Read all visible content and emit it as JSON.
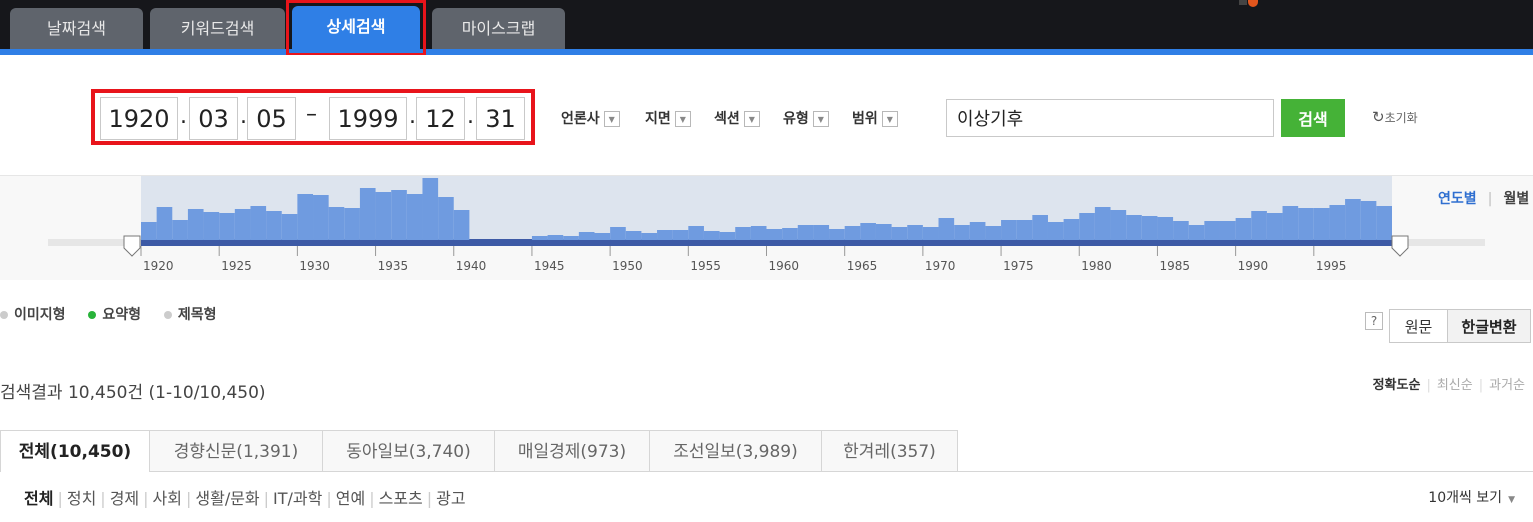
{
  "tabs": [
    {
      "label": "날짜검색",
      "active": false
    },
    {
      "label": "키워드검색",
      "active": false
    },
    {
      "label": "상세검색",
      "active": true
    },
    {
      "label": "마이스크랩",
      "active": false
    }
  ],
  "date_range": {
    "start": {
      "year": "1920",
      "month": "03",
      "day": "05"
    },
    "end": {
      "year": "1999",
      "month": "12",
      "day": "31"
    },
    "dot": ".",
    "dash": "–"
  },
  "filters": [
    "언론사",
    "지면",
    "섹션",
    "유형",
    "범위"
  ],
  "search": {
    "value": "이상기후",
    "button": "검색",
    "reset": "초기화"
  },
  "units": {
    "year": "연도별",
    "month": "월별"
  },
  "chart_data": {
    "type": "bar",
    "x_tick_labels": [
      "1920",
      "1925",
      "1930",
      "1935",
      "1940",
      "1945",
      "1950",
      "1955",
      "1960",
      "1965",
      "1970",
      "1975",
      "1980",
      "1985",
      "1990",
      "1995"
    ],
    "x": [
      1920,
      1921,
      1922,
      1923,
      1924,
      1925,
      1926,
      1927,
      1928,
      1929,
      1930,
      1931,
      1932,
      1933,
      1934,
      1935,
      1936,
      1937,
      1938,
      1939,
      1940,
      1941,
      1942,
      1943,
      1944,
      1945,
      1946,
      1947,
      1948,
      1949,
      1950,
      1951,
      1952,
      1953,
      1954,
      1955,
      1956,
      1957,
      1958,
      1959,
      1960,
      1961,
      1962,
      1963,
      1964,
      1965,
      1966,
      1967,
      1968,
      1969,
      1970,
      1971,
      1972,
      1973,
      1974,
      1975,
      1976,
      1977,
      1978,
      1979,
      1980,
      1981,
      1982,
      1983,
      1984,
      1985,
      1986,
      1987,
      1988,
      1989,
      1990,
      1991,
      1992,
      1993,
      1994,
      1995,
      1996,
      1997,
      1998,
      1999
    ],
    "values": [
      18,
      33,
      20,
      31,
      28,
      27,
      31,
      34,
      29,
      26,
      46,
      45,
      33,
      32,
      52,
      48,
      50,
      46,
      62,
      43,
      30,
      0,
      0,
      0,
      0,
      4,
      5,
      4,
      8,
      7,
      13,
      9,
      7,
      10,
      10,
      14,
      9,
      8,
      13,
      14,
      11,
      12,
      15,
      15,
      11,
      14,
      17,
      16,
      13,
      15,
      13,
      22,
      15,
      18,
      14,
      20,
      20,
      25,
      18,
      21,
      27,
      33,
      30,
      25,
      24,
      23,
      19,
      15,
      19,
      19,
      22,
      29,
      27,
      34,
      32,
      32,
      35,
      41,
      39,
      34
    ],
    "ylim": [
      0,
      64
    ]
  },
  "views": [
    {
      "label": "이미지형",
      "on": false
    },
    {
      "label": "요약형",
      "on": true
    },
    {
      "label": "제목형",
      "on": false
    }
  ],
  "help": "?",
  "text_mode": {
    "original": "원문",
    "hangul": "한글변환"
  },
  "summary": "검색결과 10,450건 (1-10/10,450)",
  "sorts": [
    {
      "label": "정확도순",
      "on": true
    },
    {
      "label": "최신순",
      "on": false
    },
    {
      "label": "과거순",
      "on": false
    }
  ],
  "publishers": [
    {
      "label": "전체(10,450)",
      "on": true
    },
    {
      "label": "경향신문(1,391)",
      "on": false
    },
    {
      "label": "동아일보(3,740)",
      "on": false
    },
    {
      "label": "매일경제(973)",
      "on": false
    },
    {
      "label": "조선일보(3,989)",
      "on": false
    },
    {
      "label": "한겨레(357)",
      "on": false
    }
  ],
  "categories": [
    {
      "label": "전체",
      "on": true
    },
    {
      "label": "정치",
      "on": false
    },
    {
      "label": "경제",
      "on": false
    },
    {
      "label": "사회",
      "on": false
    },
    {
      "label": "생활/문화",
      "on": false
    },
    {
      "label": "IT/과학",
      "on": false
    },
    {
      "label": "연예",
      "on": false
    },
    {
      "label": "스포츠",
      "on": false
    },
    {
      "label": "광고",
      "on": false
    }
  ],
  "per_page": "10개씩 보기",
  "colors": {
    "tab_active": "#2f7fe6",
    "search_button": "#45b237",
    "highlight": "#e8141b",
    "bar": "#6f9be0"
  }
}
